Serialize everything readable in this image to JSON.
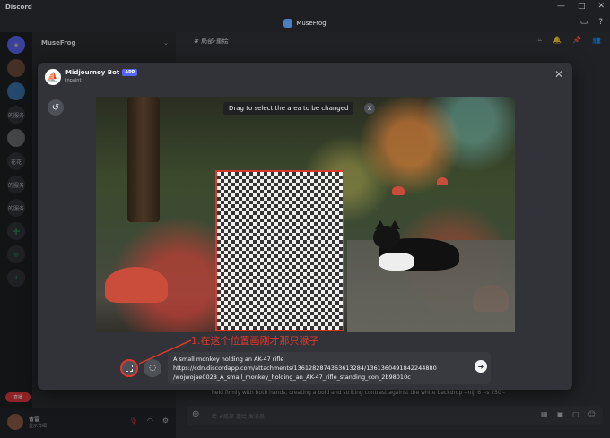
{
  "titlebar": {
    "app": "Discord",
    "minimize": "—",
    "maximize": "□",
    "close": "✕"
  },
  "topbar": {
    "server": "MuseFrog"
  },
  "sidebar": {
    "server_name": "MuseFrog",
    "rail": [
      "花花",
      "的服务",
      "的服务"
    ]
  },
  "user": {
    "name": "曹雷",
    "status": "显示详细"
  },
  "live_badge": "直播",
  "channel": {
    "name": "局部-重绘"
  },
  "bg_message": "held firmly with both hands, creating a bold and striking contrast against the white backdrop --niji 6 --s 250 -",
  "message_placeholder": "给 #局部-重绘 发消息",
  "modal": {
    "bot_name": "Midjourney Bot",
    "app_badge": "APP",
    "subtitle": "Inpaint",
    "close_label": "✕",
    "drag_hint": "Drag to select the area to be changed",
    "hint_close": "X",
    "annotation": "1.在这个位置画刚才那只猴子",
    "prompt_lines": [
      "A small monkey holding an AK-47 rifle",
      "https://cdn.discordapp.com/attachments/1361282874363613284/1361360491842244880",
      "/wojwojae0028_A_small_monkey_holding_an_AK-47_rifle_standing_con_2b98010c"
    ]
  }
}
